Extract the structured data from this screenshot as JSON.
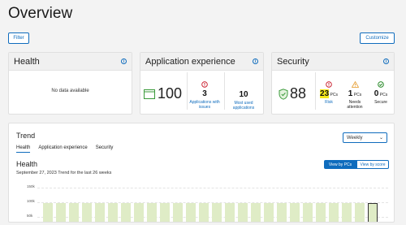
{
  "page_title": "Overview",
  "filter_label": "Filter",
  "customize_label": "Customize",
  "cards": {
    "health": {
      "title": "Health",
      "no_data": "No data available"
    },
    "app": {
      "title": "Application experience",
      "score": "100",
      "issues_value": "3",
      "issues_label": "Applications with issues",
      "most_used_value": "10",
      "most_used_label": "Most used applications"
    },
    "security": {
      "title": "Security",
      "score": "88",
      "risk_value": "23",
      "risk_unit": "PCs",
      "risk_label": "Risk",
      "attention_value": "1",
      "attention_unit": "PCs",
      "attention_label": "Needs attention",
      "secure_value": "0",
      "secure_unit": "PCs",
      "secure_label": "Secure"
    }
  },
  "trend": {
    "title": "Trend",
    "tabs": [
      "Health",
      "Application experience",
      "Security"
    ],
    "period": "Weekly",
    "section_title": "Health",
    "subtitle": "September 27, 2023 Trend for the last 26 weeks",
    "view_pcs": "View by PCs",
    "view_score": "View by score",
    "y_ticks": [
      "150k",
      "100k",
      "50k"
    ]
  },
  "chart_data": {
    "type": "bar",
    "title": "Health",
    "ylabel": "",
    "xlabel": "",
    "ylim": [
      0,
      150000
    ],
    "categories": [],
    "values": [
      96000,
      96000,
      96000,
      96000,
      96000,
      96000,
      96000,
      96000,
      96000,
      96000,
      96000,
      96000,
      96000,
      96000,
      96000,
      96000,
      96000,
      96000,
      96000,
      96000,
      96000,
      96000,
      96000,
      96000,
      96000,
      96000
    ]
  },
  "colors": {
    "accent": "#0f6cbd",
    "bar": "#dfecc6",
    "error": "#c50f1f",
    "warning": "#bc4b09",
    "success": "#107c10",
    "highlight": "#f5e71e"
  }
}
